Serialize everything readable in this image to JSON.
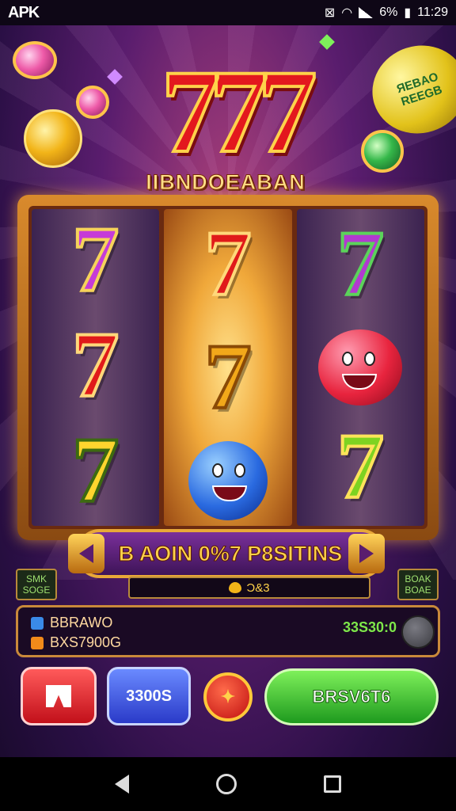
{
  "status_bar": {
    "brand": "APK",
    "battery": "6%",
    "time": "11:29"
  },
  "logo": {
    "numbers": "777",
    "subtitle": "IIBNDOEABAN"
  },
  "promo_bubble": {
    "text": "ЯEBAO\nREEGB"
  },
  "reels": [
    {
      "symbols": [
        "purple-seven",
        "red-seven",
        "yellow-seven"
      ]
    },
    {
      "symbols": [
        "red-seven",
        "gold-seven",
        "blue-face"
      ]
    },
    {
      "symbols": [
        "green-seven",
        "red-face",
        "lime-seven"
      ]
    }
  ],
  "banner": {
    "text": "B AOIN 0%7 P8SITINS"
  },
  "mini_bar": {
    "value": "Ɔ&3"
  },
  "side_left": {
    "line1": "SMK",
    "line2": "SOGE"
  },
  "side_right": {
    "line1": "BOAK",
    "line2": "BOAE"
  },
  "info_panel": {
    "row1_label": "BBRAWO",
    "row2_label": "BXS7900G",
    "amount": "33S30:0"
  },
  "buttons": {
    "red_button_icon": "flag-icon",
    "blue_label": "3300S",
    "spin_label": "✦",
    "green_label": "BRSV6T6"
  },
  "colors": {
    "accent_gold": "#ffd24a",
    "frame": "#d98a2c",
    "green_btn": "#1e9a1e",
    "red_btn": "#c2101a",
    "blue_btn": "#2a3ac8"
  }
}
